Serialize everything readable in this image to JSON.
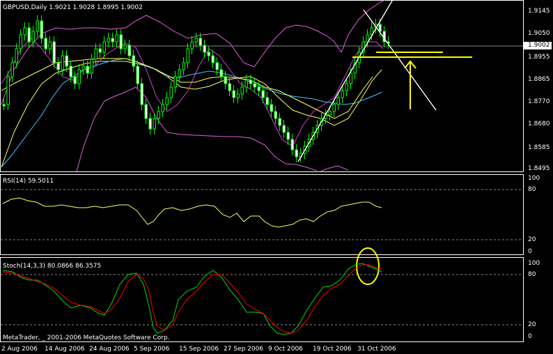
{
  "main_panel": {
    "header": "GBPUSD,Daily  1.9021 1.9028 1.8995 1.9002",
    "current_price": "1.9002",
    "axis_labels": [
      "1.9145",
      "1.9050",
      "1.8955",
      "1.8865",
      "1.8770",
      "1.8680",
      "1.8585",
      "1.8495"
    ]
  },
  "rsi_panel": {
    "header": "RSI(14) 59.5011",
    "axis_labels": [
      "100",
      "80",
      "20",
      "0"
    ]
  },
  "stoch_panel": {
    "header": "Stoch(14,3,3) 80.0866 86.3575",
    "axis_labels": [
      "100",
      "80",
      "20",
      "0"
    ]
  },
  "footer": {
    "copyright": "MetaTrader, _ 2001-2006 MetaQuotes Software Corp."
  },
  "x_axis_dates": [
    "2 Aug 2006",
    "14 Aug 2006",
    "24 Aug 2006",
    "5 Sep 2006",
    "15 Sep 2006",
    "27 Sep 2006",
    "9 Oct 2006",
    "19 Oct 2006",
    "31 Oct 2006"
  ],
  "colors": {
    "background": "#000000",
    "grid": "#ffffff",
    "candle_up": "#00ff00",
    "candle_down_body": "#ffffff",
    "bollinger": "#e060e0",
    "ma_fast": "#d040d0",
    "ma_slow_yellow": "#ffff60",
    "ma_cyan": "#40c8ff",
    "rsi_line": "#ffff60",
    "stoch_main": "#00dd00",
    "stoch_signal": "#ff0000",
    "annotation_yellow": "#ffff00",
    "trendline": "#ffffff"
  }
}
